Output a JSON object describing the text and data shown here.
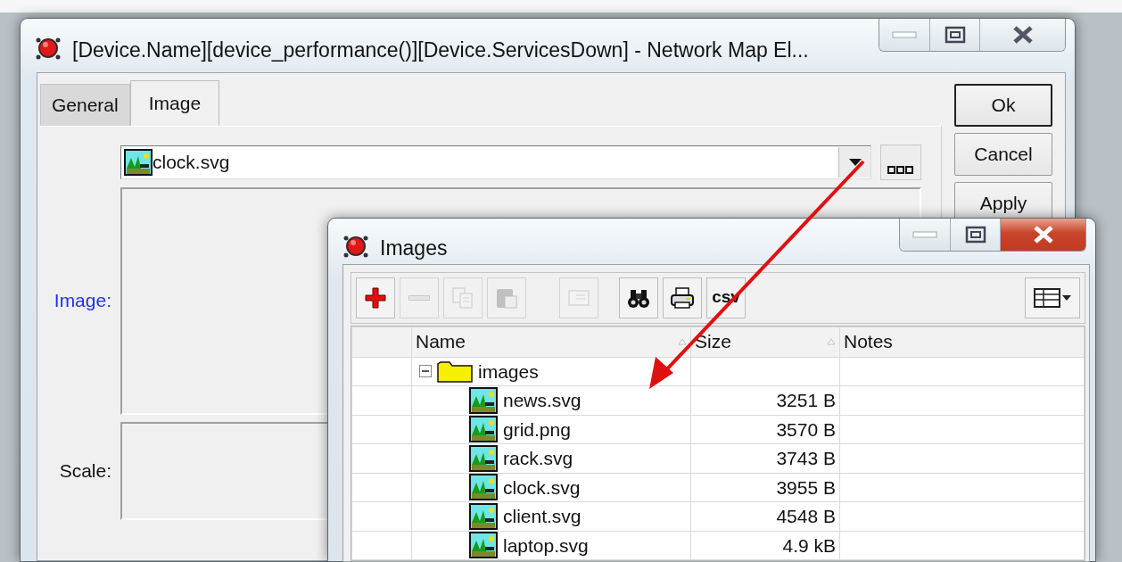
{
  "main_window": {
    "title": "[Device.Name][device_performance()][Device.ServicesDown] - Network Map El...",
    "active": false,
    "tabs": [
      {
        "label": "General",
        "selected": false
      },
      {
        "label": "Image",
        "selected": true
      }
    ],
    "image_field": {
      "value": "clock.svg"
    },
    "labels": {
      "image": "Image:",
      "scale": "Scale:"
    },
    "buttons": [
      {
        "label": "Ok",
        "default": true
      },
      {
        "label": "Cancel",
        "default": false
      },
      {
        "label": "Apply",
        "default": false
      }
    ]
  },
  "images_window": {
    "title": "Images",
    "active": true,
    "toolbar": [
      {
        "kind": "add",
        "disabled": false
      },
      {
        "kind": "remove",
        "disabled": true
      },
      {
        "kind": "copy",
        "disabled": true
      },
      {
        "kind": "paste",
        "disabled": true
      },
      {
        "kind": "card",
        "disabled": true
      },
      {
        "kind": "find",
        "disabled": false
      },
      {
        "kind": "print",
        "disabled": false
      },
      {
        "kind": "text",
        "label": "csv",
        "disabled": false
      }
    ],
    "columns": [
      {
        "label": "Name",
        "sort_arrow": true
      },
      {
        "label": "Size",
        "sort_arrow": true
      },
      {
        "label": "Notes",
        "sort_arrow": false
      }
    ],
    "tree": [
      {
        "name": "images",
        "kind": "folder",
        "expanded": true,
        "children": [
          {
            "name": "news.svg",
            "kind": "file",
            "size": "3251 B"
          },
          {
            "name": "grid.png",
            "kind": "file",
            "size": "3570 B"
          },
          {
            "name": "rack.svg",
            "kind": "file",
            "size": "3743 B"
          },
          {
            "name": "clock.svg",
            "kind": "file",
            "size": "3955 B"
          },
          {
            "name": "client.svg",
            "kind": "file",
            "size": "4548 B"
          },
          {
            "name": "laptop.svg",
            "kind": "file",
            "size": "4.9 kB"
          }
        ]
      }
    ]
  }
}
